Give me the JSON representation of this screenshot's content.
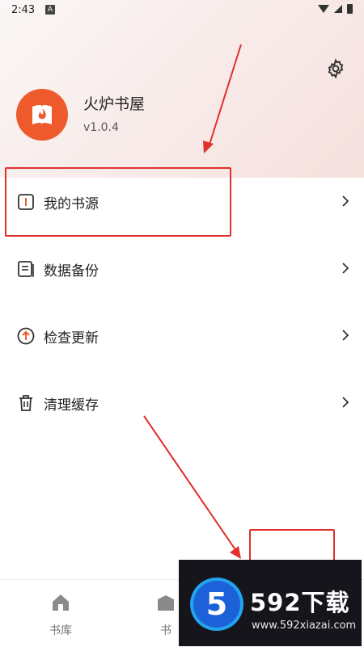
{
  "status_bar": {
    "time": "2:43",
    "badge": "A"
  },
  "profile": {
    "app_name": "火炉书屋",
    "version": "v1.0.4"
  },
  "menu": [
    {
      "label": "我的书源",
      "icon": "book-source-icon"
    },
    {
      "label": "数据备份",
      "icon": "backup-icon"
    },
    {
      "label": "检查更新",
      "icon": "update-icon"
    },
    {
      "label": "清理缓存",
      "icon": "trash-icon"
    }
  ],
  "bottom_nav": [
    {
      "label": "书库",
      "icon": "home-icon"
    },
    {
      "label": "书",
      "icon": "shelf-icon"
    }
  ],
  "watermark": {
    "badge": "5",
    "title": "592下载",
    "url": "www.592xiazai.com"
  },
  "colors": {
    "accent": "#ee5a2c",
    "highlight": "#e0302d",
    "watermark_bg": "#15151b"
  }
}
